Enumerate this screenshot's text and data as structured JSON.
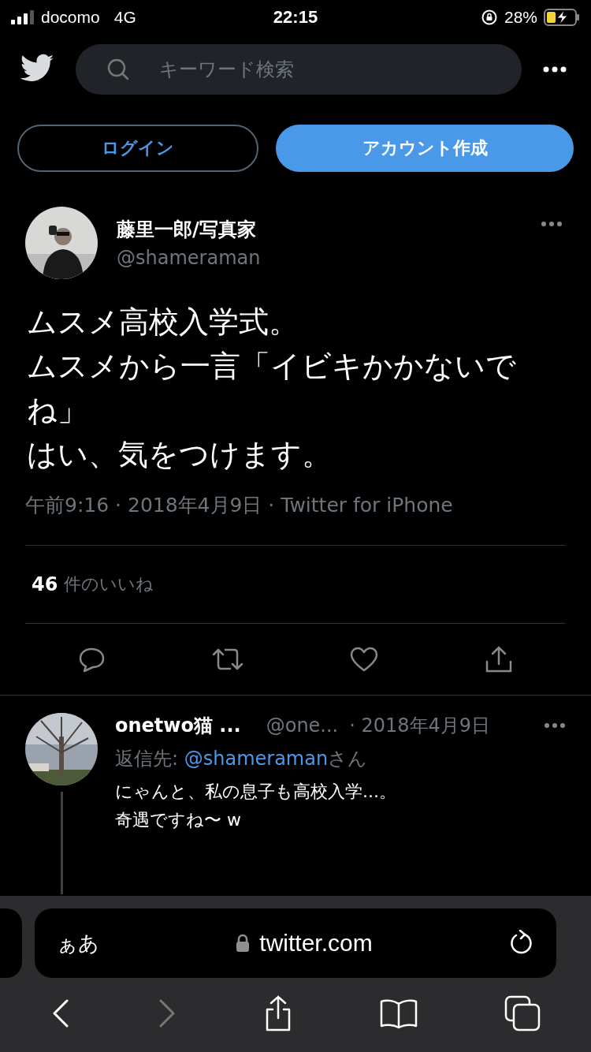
{
  "status_bar": {
    "carrier": "docomo",
    "network": "4G",
    "time": "22:15",
    "battery_percent": "28%",
    "charging": true
  },
  "header": {
    "search": {
      "placeholder": "キーワード検索"
    }
  },
  "auth_buttons": [
    {
      "label": "ログイン",
      "kind": "outline"
    },
    {
      "label": "アカウント作成",
      "kind": "filled"
    }
  ],
  "tweet": {
    "display_name": "藤里一郎/写真家",
    "handle": "@shameraman",
    "avatar": {
      "kind": "picture"
    },
    "text_lines": [
      "ムスメ高校入学式。",
      "ムスメから一言「イビキかかないでね」",
      "はい、気をつけます。"
    ],
    "meta": "午前9:16 · 2018年4月9日 · Twitter for iPhone",
    "likes_count": "46",
    "likes_label": "件のいいね"
  },
  "reply": {
    "display_name": "onetwo猫 ...",
    "handle": "@one...",
    "date": "· 2018年4月9日",
    "reply_to_label": "返信先:",
    "reply_to_handle": "@shameraman",
    "reply_to_suffix": "さん",
    "avatar": {
      "kind": "picture"
    },
    "text_lines": [
      "にゃんと、私の息子も高校入学...。",
      "奇遇ですね〜 w"
    ]
  },
  "browser": {
    "text_size": "ぁあ",
    "url": "twitter.com",
    "nav": [
      {
        "kind": "back",
        "disabled": false
      },
      {
        "kind": "forward",
        "disabled": true
      }
    ]
  }
}
